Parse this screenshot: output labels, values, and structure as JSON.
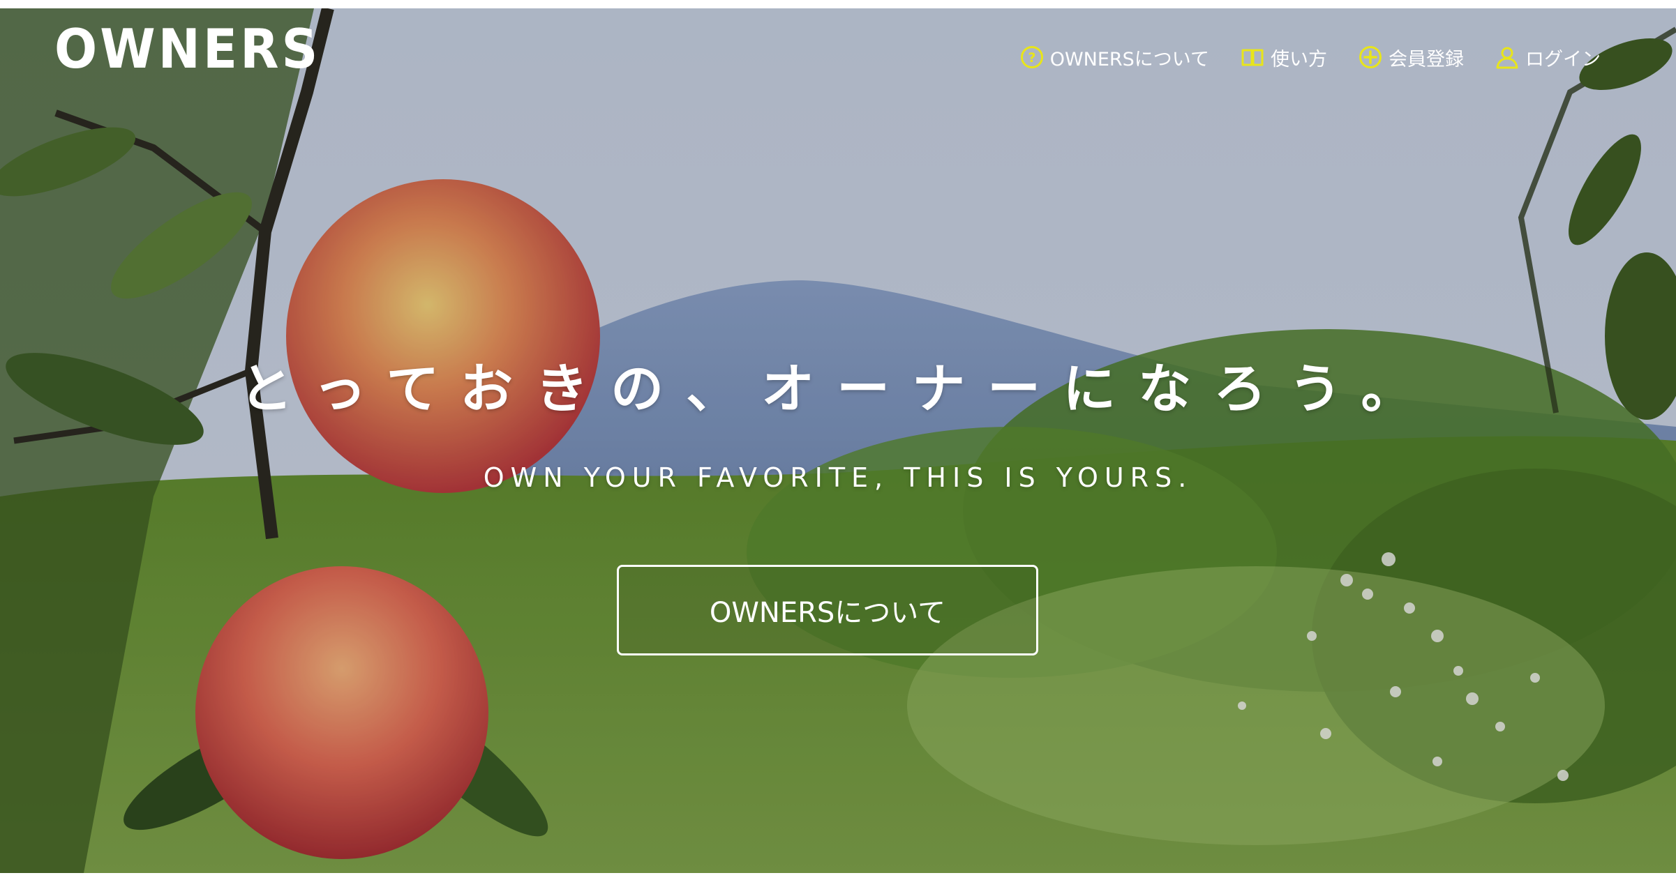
{
  "header": {
    "logo_text": "OWNERS",
    "nav": [
      {
        "icon": "question-circle-icon",
        "label": "OWNERSについて"
      },
      {
        "icon": "book-icon",
        "label": "使い方"
      },
      {
        "icon": "plus-circle-icon",
        "label": "会員登録"
      },
      {
        "icon": "user-icon",
        "label": "ログイン"
      }
    ]
  },
  "hero": {
    "headline": "とっておきの、オーナーになろう。",
    "subheadline": "OWN YOUR FAVORITE, THIS IS YOURS.",
    "cta_label": "OWNERSについて"
  },
  "colors": {
    "nav_icon_accent": "#e8e51a",
    "text": "#ffffff"
  }
}
